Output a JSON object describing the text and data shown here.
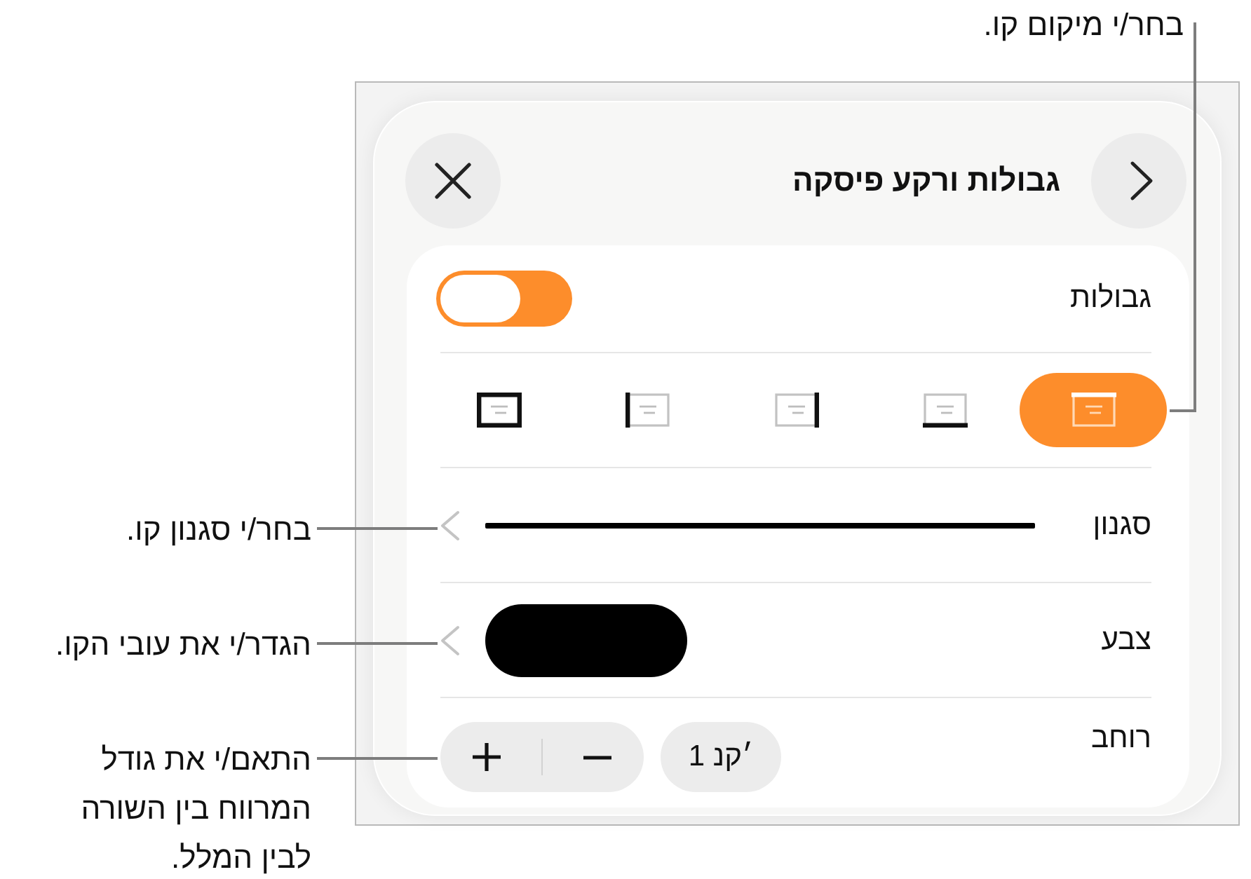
{
  "callouts": {
    "top": "בחר/י מיקום קו.",
    "left": [
      "בחר/י סגנון קו.",
      "הגדר/י את עובי הקו.",
      "התאם/י את גודל המרווח בין השורה לבין המלל."
    ]
  },
  "popover": {
    "title": "גבולות ורקע פיסקה",
    "rows": [
      {
        "kind": "toggle",
        "label": "גבולות",
        "on": true
      },
      {
        "kind": "segments",
        "options": [
          {
            "kind": "top",
            "selected": true
          },
          {
            "kind": "bottom",
            "selected": false
          },
          {
            "kind": "right",
            "selected": false
          },
          {
            "kind": "left",
            "selected": false
          },
          {
            "kind": "all",
            "selected": false
          }
        ]
      },
      {
        "kind": "line",
        "label": "סגנון"
      },
      {
        "kind": "color",
        "label": "צבע",
        "color": "#000000"
      },
      {
        "kind": "stepper",
        "label": "רוחב",
        "value": "1 נק׳"
      }
    ]
  }
}
